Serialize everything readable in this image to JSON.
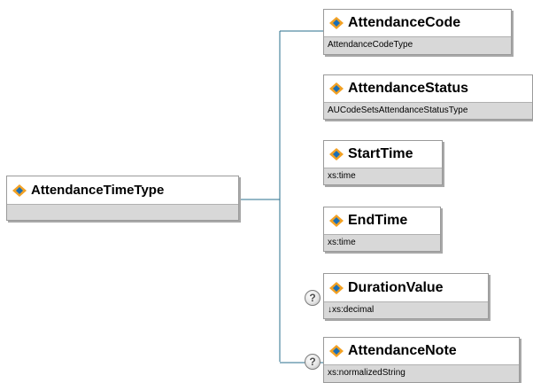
{
  "root": {
    "name": "AttendanceTimeType",
    "icon": "element-icon"
  },
  "children": [
    {
      "name": "AttendanceCode",
      "type": "AttendanceCodeType",
      "icon": "element-icon",
      "optional": false
    },
    {
      "name": "AttendanceStatus",
      "type": "AUCodeSetsAttendanceStatusType",
      "icon": "element-icon",
      "optional": false
    },
    {
      "name": "StartTime",
      "type": "xs:time",
      "icon": "element-icon",
      "optional": false
    },
    {
      "name": "EndTime",
      "type": "xs:time",
      "icon": "element-icon",
      "optional": false
    },
    {
      "name": "DurationValue",
      "type": "↓xs:decimal",
      "icon": "element-icon",
      "optional": true,
      "optional_marker": "?"
    },
    {
      "name": "AttendanceNote",
      "type": "xs:normalizedString",
      "icon": "element-icon",
      "optional": true,
      "optional_marker": "?"
    }
  ],
  "colors": {
    "connector": "#2a6f8e",
    "icon_orange": "#f2a124",
    "icon_blue": "#1a6fb6",
    "node_border": "#9a9a9a",
    "type_band": "#d8d8d8"
  }
}
